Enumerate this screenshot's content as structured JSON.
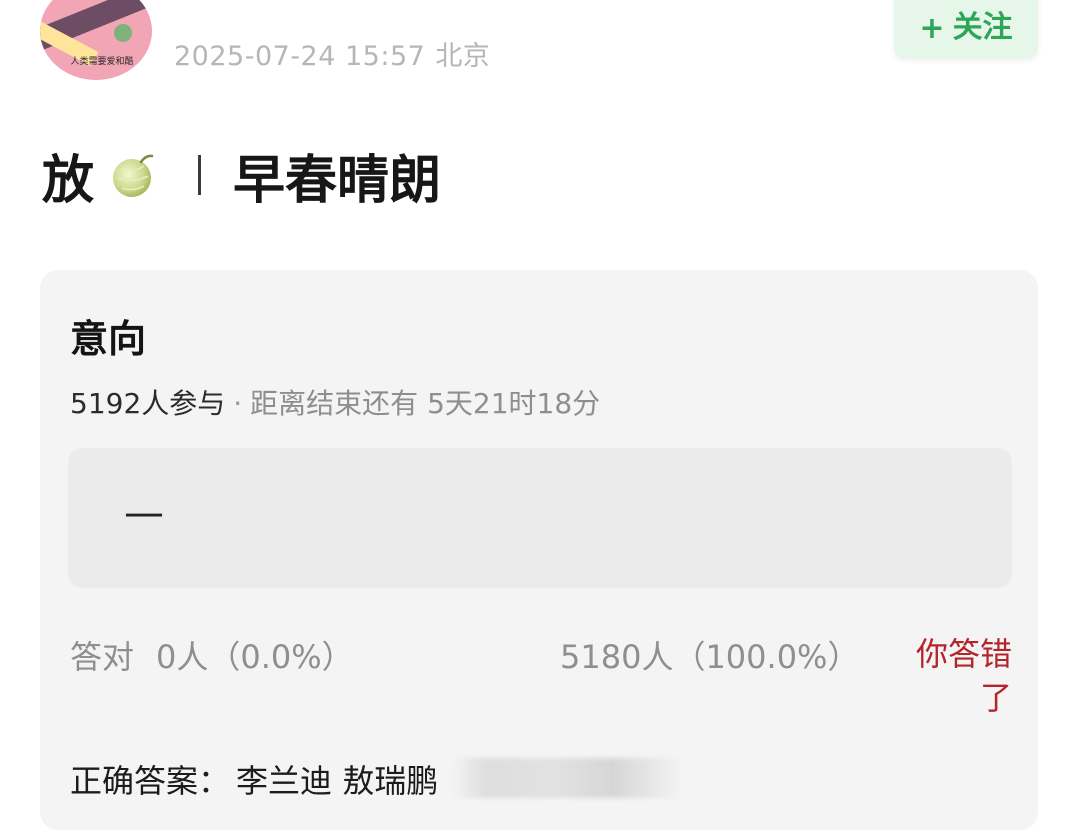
{
  "header": {
    "avatar_caption": "人类需要爱和酷",
    "timestamp": "2025-07-24 15:57",
    "location": "北京",
    "follow_plus": "+",
    "follow_label": "关注",
    "follow_color": "#2fa55a"
  },
  "post": {
    "title_prefix": "放",
    "title_icon": "melon-icon",
    "title_main": "早春晴朗"
  },
  "poll": {
    "title": "意向",
    "participants": "5192人参与",
    "separator": "·",
    "countdown": "距离结束还有 5天21时18分",
    "answer_value": "—",
    "correct_label": "答对",
    "correct_count": "0人（0.0%）",
    "wrong_count": "5180人（100.0%）",
    "wrong_notice": "你答错了",
    "wrong_color": "#b4252b",
    "correct_answer_label": "正确答案：",
    "correct_answer_value": "李兰迪 敖瑞鹏"
  }
}
